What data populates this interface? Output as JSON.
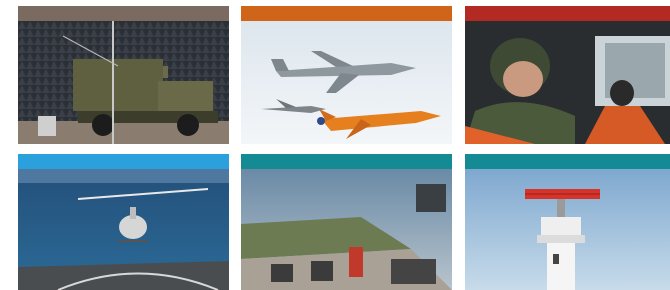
{
  "gallery": {
    "tiles": [
      {
        "name": "anechoic-chamber-radar-truck",
        "accent": "#7a6a60"
      },
      {
        "name": "tanker-aircraft-refuelling-jets",
        "accent": "#d0651a"
      },
      {
        "name": "pilots-in-cockpit",
        "accent": "#b22a22"
      },
      {
        "name": "helicopter-over-ship-deck",
        "accent": "#2aa0dc"
      },
      {
        "name": "flight-simulator-dome",
        "accent": "#148a95"
      },
      {
        "name": "radar-tower",
        "accent": "#148a95"
      }
    ]
  }
}
